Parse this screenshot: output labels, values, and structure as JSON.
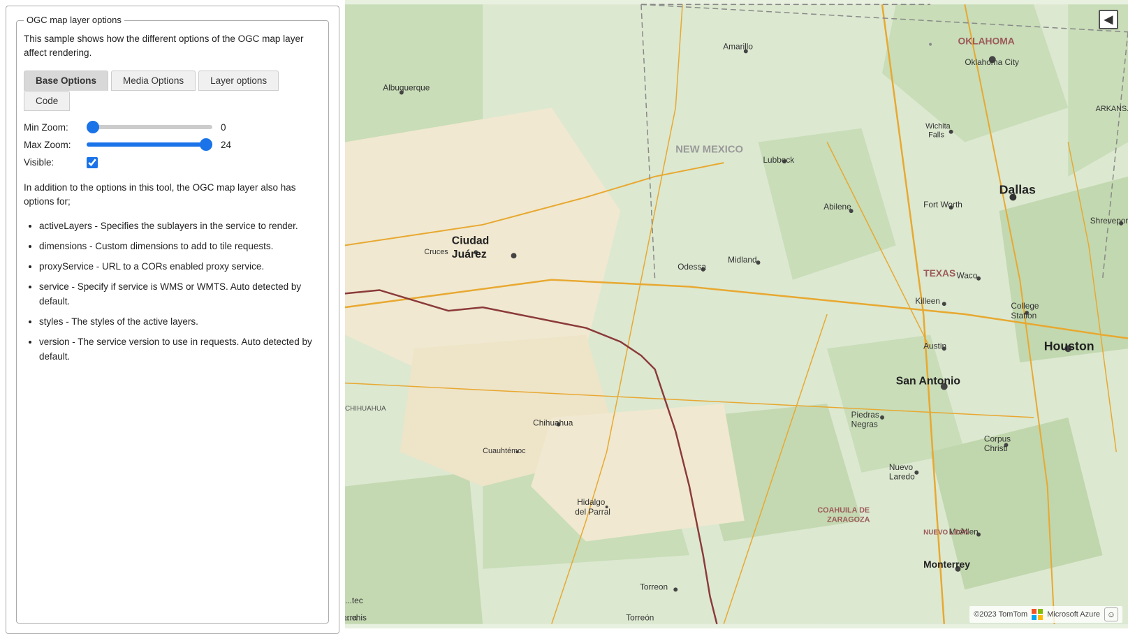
{
  "panel": {
    "title": "OGC map layer options",
    "intro": "This sample shows how the different options of the OGC map layer affect rendering.",
    "tabs": [
      {
        "label": "Base Options",
        "active": true
      },
      {
        "label": "Media Options",
        "active": false
      },
      {
        "label": "Layer options",
        "active": false
      }
    ],
    "second_tabs": [
      {
        "label": "Code",
        "active": false
      }
    ],
    "controls": {
      "min_zoom_label": "Min Zoom:",
      "min_zoom_value": "0",
      "min_zoom_pct": 0,
      "max_zoom_label": "Max Zoom:",
      "max_zoom_value": "24",
      "max_zoom_pct": 100,
      "visible_label": "Visible:",
      "visible_checked": true
    },
    "description": "In addition to the options in this tool, the OGC map layer also has options for;",
    "bullets": [
      "activeLayers - Specifies the sublayers in the service to render.",
      "dimensions - Custom dimensions to add to tile requests.",
      "proxyService - URL to a CORs enabled proxy service.",
      "service - Specify if service is WMS or WMTS. Auto detected by default.",
      "styles - The styles of the active layers.",
      "version - The service version to use in requests. Auto detected by default."
    ]
  },
  "map": {
    "collapse_icon": "◀",
    "attribution": "©2023 TomTom",
    "ms_label": "Microsoft Azure",
    "smiley": "☺"
  }
}
